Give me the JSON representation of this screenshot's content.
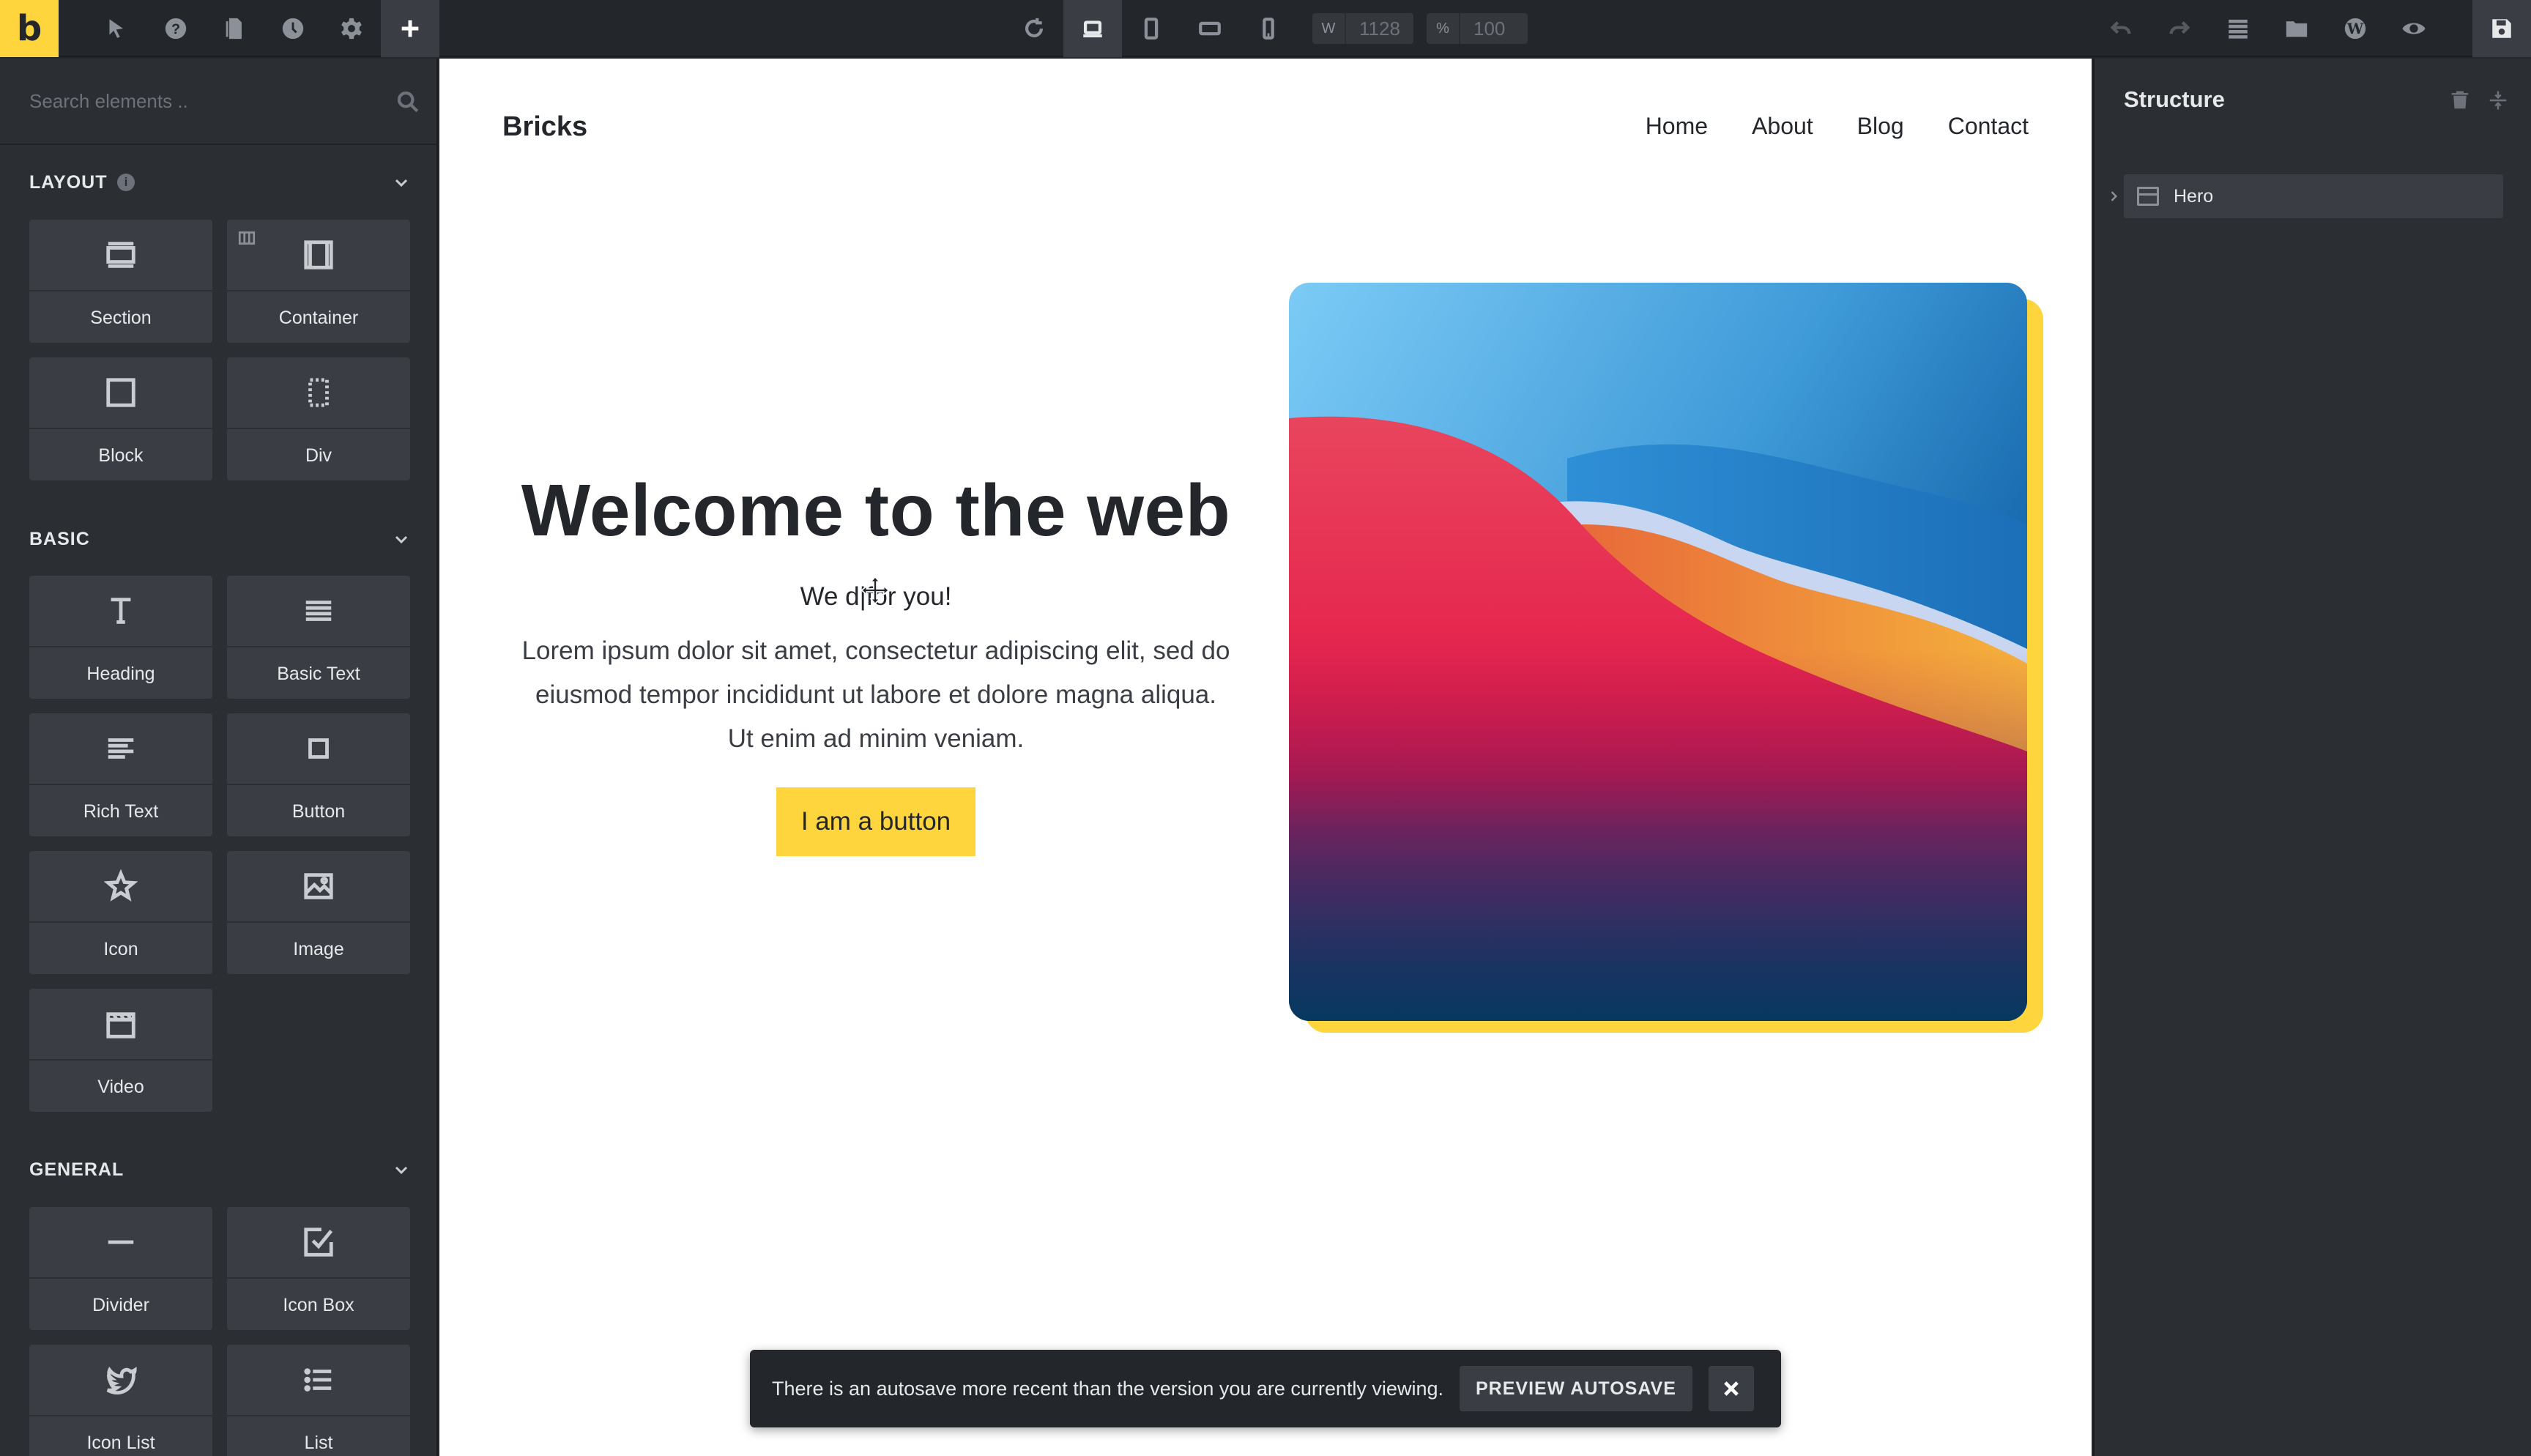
{
  "toolbar": {
    "logo": "b",
    "width_label": "W",
    "width_value": "1128",
    "zoom_label": "%",
    "zoom_value": "100"
  },
  "elements_panel": {
    "search_placeholder": "Search elements ..",
    "categories": [
      {
        "name": "LAYOUT",
        "items": [
          "Section",
          "Container",
          "Block",
          "Div"
        ]
      },
      {
        "name": "BASIC",
        "items": [
          "Heading",
          "Basic Text",
          "Rich Text",
          "Button",
          "Icon",
          "Image",
          "Video"
        ]
      },
      {
        "name": "GENERAL",
        "items": [
          "Divider",
          "Icon Box",
          "Icon List",
          "List"
        ]
      }
    ]
  },
  "canvas": {
    "site_logo": "Bricks",
    "nav": [
      "Home",
      "About",
      "Blog",
      "Contact"
    ],
    "hero": {
      "title": "Welcome to the web",
      "subtitle": "We d|for you!",
      "body_lines": [
        "Lorem ipsum dolor sit amet, consectetur adipiscing elit, sed do",
        "eiusmod tempor incididunt ut labore et dolore magna aliqua.",
        "Ut enim ad minim veniam."
      ],
      "button": "I am a button"
    },
    "accent_color": "#ffd53e"
  },
  "toast": {
    "message": "There is an autosave more recent than the version you are currently viewing.",
    "button": "PREVIEW AUTOSAVE"
  },
  "structure_panel": {
    "title": "Structure",
    "items": [
      "Hero"
    ]
  }
}
